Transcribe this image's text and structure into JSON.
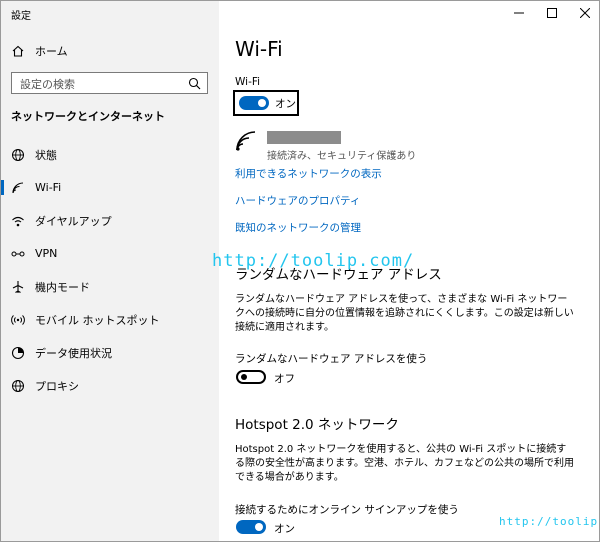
{
  "window": {
    "title": "設定"
  },
  "sidebar": {
    "home_label": "ホーム",
    "search_placeholder": "設定の検索",
    "section_title": "ネットワークとインターネット",
    "items": [
      {
        "label": "状態",
        "icon": "globe-status-icon"
      },
      {
        "label": "Wi-Fi",
        "icon": "wifi-icon",
        "selected": true
      },
      {
        "label": "ダイヤルアップ",
        "icon": "dialup-icon"
      },
      {
        "label": "VPN",
        "icon": "vpn-icon"
      },
      {
        "label": "機内モード",
        "icon": "airplane-icon"
      },
      {
        "label": "モバイル ホットスポット",
        "icon": "hotspot-icon"
      },
      {
        "label": "データ使用状況",
        "icon": "data-usage-icon"
      },
      {
        "label": "プロキシ",
        "icon": "proxy-globe-icon"
      }
    ]
  },
  "main": {
    "title": "Wi-Fi",
    "wifi_label": "Wi-Fi",
    "wifi_toggle_state": "オン",
    "network_status": "接続済み、セキュリティ保護あり",
    "links": [
      "利用できるネットワークの表示",
      "ハードウェアのプロパティ",
      "既知のネットワークの管理"
    ],
    "random_hw": {
      "heading": "ランダムなハードウェア アドレス",
      "description": "ランダムなハードウェア アドレスを使って、さまざまな Wi-Fi ネットワークへの接続時に自分の位置情報を追跡されにくくします。この設定は新しい接続に適用されます。",
      "toggle_label": "ランダムなハードウェア アドレスを使う",
      "toggle_state": "オフ"
    },
    "hotspot20": {
      "heading": "Hotspot 2.0 ネットワーク",
      "description": "Hotspot 2.0 ネットワークを使用すると、公共の Wi-Fi スポットに接続する際の安全性が高まります。空港、ホテル、カフェなどの公共の場所で利用できる場合があります。",
      "toggle_label": "接続するためにオンライン サインアップを使う",
      "toggle_state": "オン"
    }
  },
  "watermarks": [
    "http://toolip.com/",
    "http://toolip.com"
  ],
  "colors": {
    "accent": "#0067c0",
    "sidebar_bg": "#f2f2f2",
    "watermark": "#22c5ee",
    "redacted": "#8c8c8c"
  }
}
